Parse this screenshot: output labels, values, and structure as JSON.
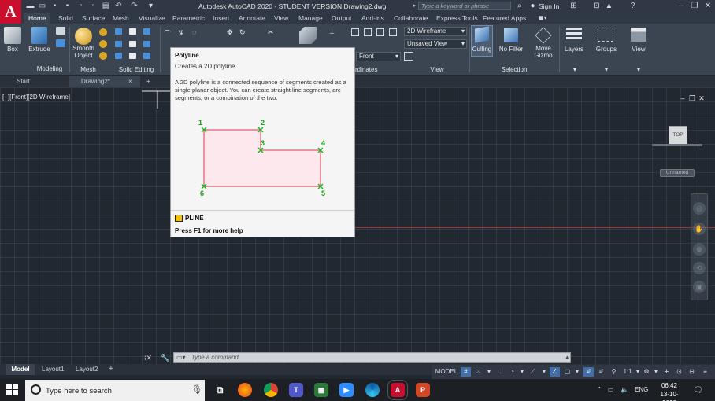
{
  "titlebar": {
    "app_logo": "A",
    "title": "Autodesk AutoCAD 2020 - STUDENT VERSION    Drawing2.dwg",
    "search_placeholder": "Type a keyword or phrase",
    "signin": "Sign In"
  },
  "ribbon_tabs": [
    "Home",
    "Solid",
    "Surface",
    "Mesh",
    "Visualize",
    "Parametric",
    "Insert",
    "Annotate",
    "View",
    "Manage",
    "Output",
    "Add-ins",
    "Collaborate",
    "Express Tools",
    "Featured Apps"
  ],
  "ribbon": {
    "box": "Box",
    "extrude": "Extrude",
    "smooth_object": "Smooth\nObject",
    "panel_modeling": "Modeling",
    "panel_mesh": "Mesh",
    "panel_solid_editing": "Solid Editing",
    "visual_style": "2D Wireframe",
    "saved_view": "Unsaved View",
    "view_direction": "Front",
    "panel_coordinates": "rdinates",
    "panel_view": "View",
    "culling": "Culling",
    "no_filter": "No Filter",
    "move_gizmo": "Move\nGizmo",
    "panel_selection": "Selection",
    "layers": "Layers",
    "groups": "Groups",
    "view_big": "View"
  },
  "doc_tabs": {
    "start": "Start",
    "drawing2": "Drawing2*",
    "close": "×",
    "new": "+"
  },
  "viewport": {
    "label": "[−][Front][2D Wireframe]",
    "viewcube_face": "TOP",
    "ucs_name": "Unnamed"
  },
  "tooltip": {
    "title": "Polyline",
    "subtitle": "Creates a 2D polyline",
    "description": "A 2D polyline is a connected sequence of segments created as a single planar object. You can create straight line segments, arc segments, or a combination of the two.",
    "points": [
      "1",
      "2",
      "3",
      "4",
      "5",
      "6"
    ],
    "command": "PLINE",
    "help": "Press F1 for more help"
  },
  "command_line": {
    "placeholder": "Type a command"
  },
  "layout_tabs": [
    "Model",
    "Layout1",
    "Layout2"
  ],
  "status": {
    "model": "MODEL",
    "scale": "1:1"
  },
  "taskbar": {
    "search": "Type here to search",
    "lang": "ENG",
    "time": "06:42",
    "date": "13-10-2020"
  },
  "colors": {
    "accent": "#3f6ea8",
    "autocad_red": "#c8102e",
    "polyline_marker": "#22b122",
    "polyline_stroke": "#d9374f"
  }
}
